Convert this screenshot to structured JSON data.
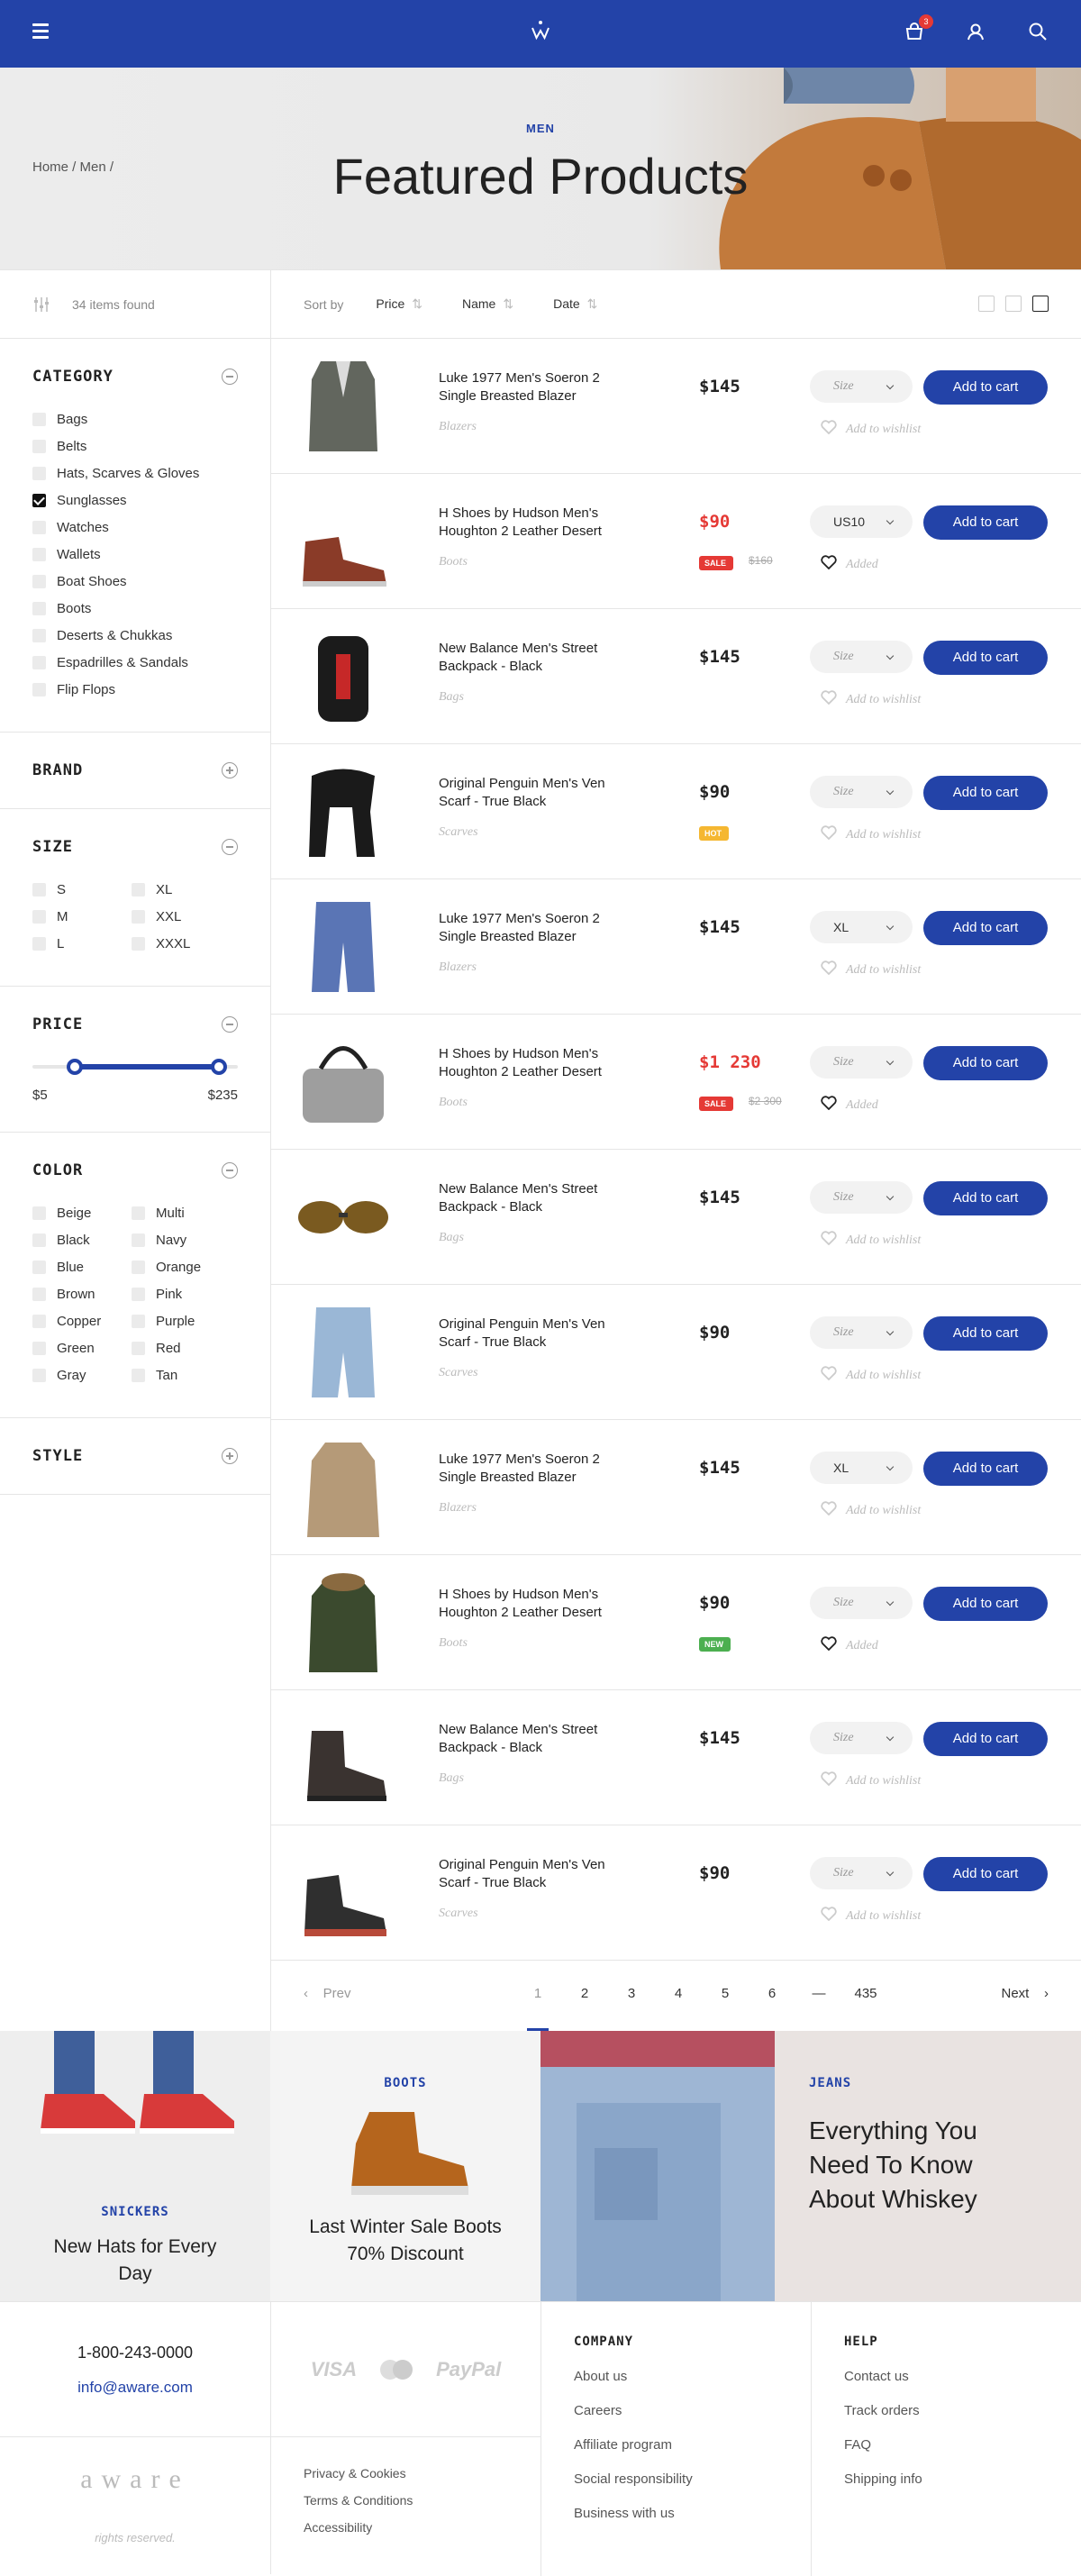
{
  "header": {
    "cart_count": "3"
  },
  "hero": {
    "breadcrumb": "Home / Men /",
    "category": "MEN",
    "title": "Featured Products"
  },
  "sidebar": {
    "found": "34 items found",
    "category": {
      "title": "CATEGORY",
      "items": [
        {
          "label": "Bags",
          "checked": false
        },
        {
          "label": "Belts",
          "checked": false
        },
        {
          "label": "Hats, Scarves & Gloves",
          "checked": false
        },
        {
          "label": "Sunglasses",
          "checked": true
        },
        {
          "label": "Watches",
          "checked": false
        },
        {
          "label": "Wallets",
          "checked": false
        },
        {
          "label": "Boat Shoes",
          "checked": false
        },
        {
          "label": "Boots",
          "checked": false
        },
        {
          "label": "Deserts & Chukkas",
          "checked": false
        },
        {
          "label": "Espadrilles & Sandals",
          "checked": false
        },
        {
          "label": "Flip Flops",
          "checked": false
        }
      ]
    },
    "brand": {
      "title": "BRAND"
    },
    "size": {
      "title": "SIZE",
      "items": [
        "S",
        "XL",
        "M",
        "XXL",
        "L",
        "XXXL"
      ]
    },
    "price": {
      "title": "PRICE",
      "min": "$5",
      "max": "$235"
    },
    "color": {
      "title": "COLOR",
      "items": [
        "Beige",
        "Multi",
        "Black",
        "Navy",
        "Blue",
        "Orange",
        "Brown",
        "Pink",
        "Copper",
        "Purple",
        "Green",
        "Red",
        "Gray",
        "Tan"
      ]
    },
    "style": {
      "title": "STYLE"
    }
  },
  "sort": {
    "label": "Sort by",
    "options": [
      "Price",
      "Name",
      "Date"
    ]
  },
  "products": [
    {
      "name": "Luke 1977 Men's Soeron 2 Single Breasted Blazer",
      "category": "Blazers",
      "price": "$145",
      "sale": false,
      "size": "Size",
      "wish": "Add to wishlist",
      "kind": "blazer"
    },
    {
      "name": "H Shoes by Hudson Men's Houghton 2 Leather Desert",
      "category": "Boots",
      "price": "$90",
      "sale": true,
      "tag": "SALE",
      "old": "$160",
      "size": "US10",
      "wish": "Added",
      "kind": "shoe"
    },
    {
      "name": "New Balance Men's Street Backpack - Black",
      "category": "Bags",
      "price": "$145",
      "sale": false,
      "size": "Size",
      "wish": "Add to wishlist",
      "kind": "backpack"
    },
    {
      "name": "Original Penguin Men's Ven Scarf - True Black",
      "category": "Scarves",
      "price": "$90",
      "sale": false,
      "tag": "HOT",
      "size": "Size",
      "wish": "Add to wishlist",
      "kind": "scarf"
    },
    {
      "name": "Luke 1977 Men's Soeron 2 Single Breasted Blazer",
      "category": "Blazers",
      "price": "$145",
      "sale": false,
      "size": "XL",
      "wish": "Add to wishlist",
      "kind": "shorts"
    },
    {
      "name": "H Shoes by Hudson Men's Houghton 2 Leather Desert",
      "category": "Boots",
      "price": "$1 230",
      "sale": true,
      "tag": "SALE",
      "old": "$2 300",
      "size": "Size",
      "wish": "Added",
      "kind": "bag"
    },
    {
      "name": "New Balance Men's Street Backpack - Black",
      "category": "Bags",
      "price": "$145",
      "sale": false,
      "size": "Size",
      "wish": "Add to wishlist",
      "kind": "glasses"
    },
    {
      "name": "Original Penguin Men's Ven Scarf - True Black",
      "category": "Scarves",
      "price": "$90",
      "sale": false,
      "size": "Size",
      "wish": "Add to wishlist",
      "kind": "jeans"
    },
    {
      "name": "Luke 1977 Men's Soeron 2 Single Breasted Blazer",
      "category": "Blazers",
      "price": "$145",
      "sale": false,
      "size": "XL",
      "wish": "Add to wishlist",
      "kind": "coat"
    },
    {
      "name": "H Shoes by Hudson Men's Houghton 2 Leather Desert",
      "category": "Boots",
      "price": "$90",
      "sale": false,
      "tag": "NEW",
      "size": "Size",
      "wish": "Added",
      "kind": "parka"
    },
    {
      "name": "New Balance Men's Street Backpack - Black",
      "category": "Bags",
      "price": "$145",
      "sale": false,
      "size": "Size",
      "wish": "Add to wishlist",
      "kind": "boot"
    },
    {
      "name": "Original Penguin Men's Ven Scarf - True Black",
      "category": "Scarves",
      "price": "$90",
      "sale": false,
      "size": "Size",
      "wish": "Add to wishlist",
      "kind": "sneaker"
    }
  ],
  "cart_label": "Add to cart",
  "pagination": {
    "prev": "Prev",
    "pages": [
      "1",
      "2",
      "3",
      "4",
      "5",
      "6",
      "—",
      "435"
    ],
    "next": "Next"
  },
  "promos": [
    {
      "tag": "SNICKERS",
      "text": "New Hats for Every Day"
    },
    {
      "tag": "BOOTS",
      "text": "Last Winter Sale Boots 70% Discount"
    },
    {
      "tag": "JEANS",
      "text": "Everything You Need To Know About Whiskey"
    }
  ],
  "footer": {
    "phone": "1-800-243-0000",
    "email": "info@aware.com",
    "payments": [
      "VISA",
      "PayPal"
    ],
    "logo": "aware",
    "copyright": "rights reserved.",
    "legal": [
      "Privacy & Cookies",
      "Terms & Conditions",
      "Accessibility"
    ],
    "company": {
      "title": "COMPANY",
      "links": [
        "About us",
        "Careers",
        "Affiliate program",
        "Social responsibility",
        "Business with us"
      ]
    },
    "help": {
      "title": "HELP",
      "links": [
        "Contact us",
        "Track orders",
        "FAQ",
        "Shipping info"
      ]
    }
  },
  "colors": {
    "brand": "#2343a8",
    "sale": "#e53935",
    "hot": "#f5b731",
    "new": "#4caf50"
  }
}
